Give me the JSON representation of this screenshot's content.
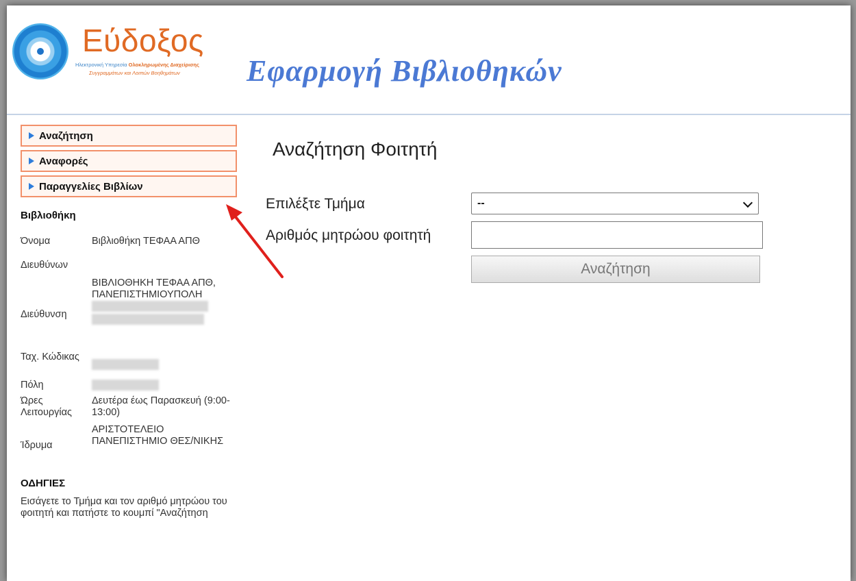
{
  "logo": {
    "name": "Εύδοξος",
    "sub_line1_prefix": "Ηλεκτρονική Υπηρεσία",
    "sub_line1_bold": "Ολοκληρωμένης Διαχείρισης",
    "sub_line2": "Συγγραμμάτων και Λοιπών Βοηθημάτων"
  },
  "app_title": "Εφαρμογή Βιβλιοθηκών",
  "menu": [
    {
      "label": "Αναζήτηση"
    },
    {
      "label": "Αναφορές"
    },
    {
      "label": "Παραγγελίες Βιβλίων"
    }
  ],
  "library": {
    "title": "Βιβλιοθήκη",
    "rows": {
      "name": {
        "key": "Όνομα",
        "value": "Βιβλιοθήκη ΤΕΦΑΑ ΑΠΘ"
      },
      "director": {
        "key": "Διευθύνων",
        "value": ""
      },
      "address": {
        "key": "Διεύθυνση",
        "value": "ΒΙΒΛΙΟΘΗΚΗ ΤΕΦΑΑ ΑΠΘ, ΠΑΝΕΠΙΣΤΗΜΙΟΥΠΟΛΗ"
      },
      "postal": {
        "key": "Ταχ. Κώδικας"
      },
      "city": {
        "key": "Πόλη"
      },
      "hours": {
        "key": "Ώρες Λειτουργίας",
        "value": "Δευτέρα έως Παρασκευή (9:00-13:00)"
      },
      "institution": {
        "key": "Ίδρυμα",
        "value": "ΑΡΙΣΤΟΤΕΛΕΙΟ ΠΑΝΕΠΙΣΤΗΜΙΟ ΘΕΣ/ΝΙΚΗΣ"
      }
    }
  },
  "instructions": {
    "title": "ΟΔΗΓΙΕΣ",
    "text": "Εισάγετε το Τμήμα και τον αριθμό μητρώου του φοιτητή και πατήστε το κουμπί \"Αναζήτηση"
  },
  "main": {
    "title": "Αναζήτηση Φοιτητή",
    "department_label": "Επιλέξτε Τμήμα",
    "department_selected": "--",
    "student_id_label": "Αριθμός μητρώου φοιτητή",
    "student_id_value": "",
    "search_button": "Αναζήτηση"
  },
  "colors": {
    "menu_border": "#f2906a",
    "menu_triangle": "#2e7ddb",
    "title_blue": "#4b79d4",
    "logo_orange": "#e06a24",
    "arrow_red": "#e0201c"
  }
}
